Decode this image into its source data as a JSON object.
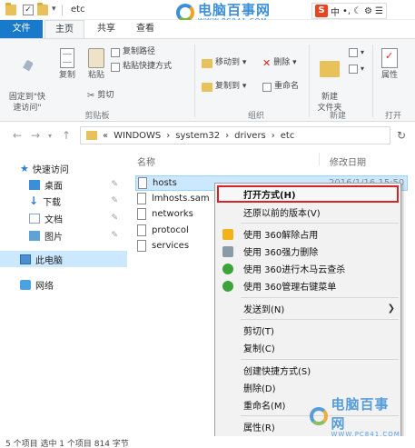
{
  "window": {
    "title": "etc"
  },
  "ribbon_tabs": [
    "文件",
    "主页",
    "共享",
    "查看"
  ],
  "ime": {
    "s": "S",
    "items": [
      "中",
      "•,",
      "☾",
      "⚙",
      "☰"
    ]
  },
  "watermark": {
    "name": "电脑百事网",
    "url": "WWW.PC841.COM"
  },
  "ribbon": {
    "pin_label": "固定到\"快\n速访问\"",
    "copy_label": "复制",
    "paste_label": "粘贴",
    "copy_path": "复制路径",
    "paste_shortcut": "粘贴快捷方式",
    "cut": "剪切",
    "clipboard_group": "剪贴板",
    "move_to": "移动到 ▾",
    "copy_to": "复制到 ▾",
    "delete": "删除 ▾",
    "rename": "重命名",
    "organize_group": "组织",
    "new_folder": "新建\n文件夹",
    "new_group": "新建",
    "properties": "属性",
    "open_group": "打开"
  },
  "address": {
    "parts": [
      "«",
      "WINDOWS",
      "›",
      "system32",
      "›",
      "drivers",
      "›",
      "etc"
    ]
  },
  "nav_pane": {
    "quick_access": "快速访问",
    "items": [
      "桌面",
      "下载",
      "文档",
      "图片"
    ],
    "this_pc": "此电脑",
    "network": "网络"
  },
  "file_list": {
    "col_name": "名称",
    "col_date": "修改日期",
    "files": [
      "hosts",
      "lmhosts.sam",
      "networks",
      "protocol",
      "services"
    ],
    "hosts_date": "2016/1/16 15:50"
  },
  "context_menu": {
    "items": [
      "打开方式(H)",
      "还原以前的版本(V)",
      "使用 360解除占用",
      "使用 360强力删除",
      "使用 360进行木马云查杀",
      "使用 360管理右键菜单",
      "发送到(N)",
      "剪切(T)",
      "复制(C)",
      "创建快捷方式(S)",
      "删除(D)",
      "重命名(M)",
      "属性(R)"
    ]
  },
  "status_bar": {
    "text": "5 个项目    选中 1 个项目  814 字节"
  }
}
